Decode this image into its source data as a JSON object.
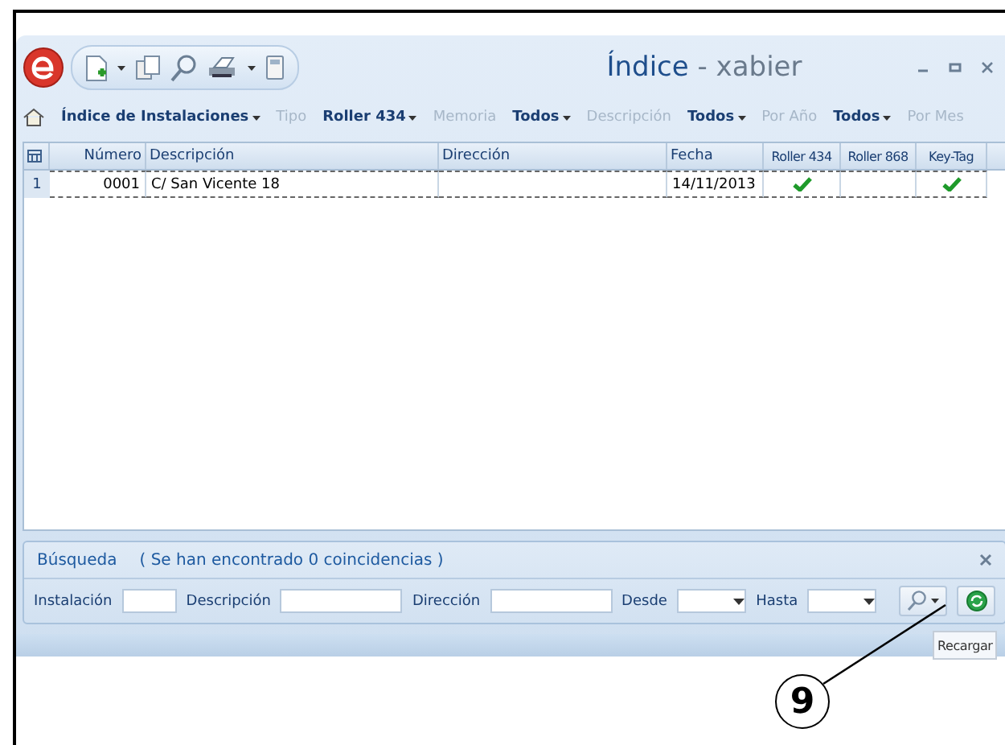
{
  "window": {
    "title": "Índice",
    "subtitle": "- xabier"
  },
  "toolbar": [
    {
      "kind": "dropdown",
      "label": "Índice de Instalaciones"
    },
    {
      "kind": "label",
      "label": "Tipo"
    },
    {
      "kind": "dropdown",
      "label": "Roller 434"
    },
    {
      "kind": "label",
      "label": "Memoria"
    },
    {
      "kind": "dropdown",
      "label": "Todos"
    },
    {
      "kind": "label",
      "label": "Descripción"
    },
    {
      "kind": "dropdown",
      "label": "Todos"
    },
    {
      "kind": "label",
      "label": "Por Año"
    },
    {
      "kind": "dropdown",
      "label": "Todos"
    },
    {
      "kind": "label",
      "label": "Por Mes"
    }
  ],
  "table": {
    "columns": [
      {
        "label": "Número",
        "kind": "text"
      },
      {
        "label": "Descripción",
        "kind": "text"
      },
      {
        "label": "Dirección",
        "kind": "text"
      },
      {
        "label": "Fecha",
        "kind": "text"
      },
      {
        "label": "Roller 434",
        "kind": "check"
      },
      {
        "label": "Roller 868",
        "kind": "check"
      },
      {
        "label": "Key-Tag",
        "kind": "check"
      }
    ],
    "rows": [
      {
        "row_number": "1",
        "selected": true,
        "cells": [
          "0001",
          "C/ San Vicente 18",
          "",
          "14/11/2013",
          true,
          false,
          true
        ]
      }
    ]
  },
  "search": {
    "title": "Búsqueda",
    "message": "( Se han encontrado 0 coincidencias )",
    "fields": [
      {
        "kind": "text",
        "label": "Instalación"
      },
      {
        "kind": "text",
        "label": "Descripción"
      },
      {
        "kind": "text",
        "label": "Dirección"
      },
      {
        "kind": "date",
        "label": "Desde"
      },
      {
        "kind": "date",
        "label": "Hasta"
      }
    ]
  },
  "tooltip": "Recargar",
  "callout": "9"
}
